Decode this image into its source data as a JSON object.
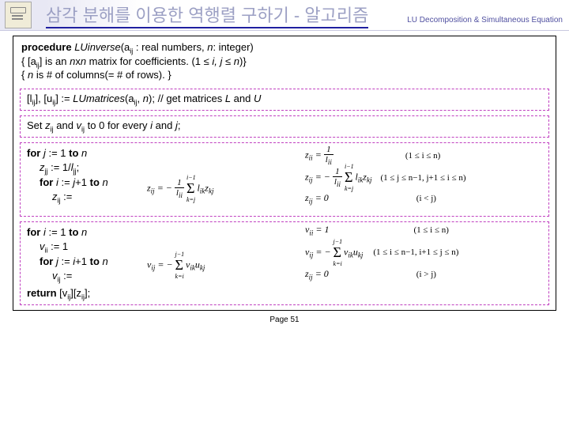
{
  "header": {
    "title": "삼각 분해를 이용한 역행렬 구하기 - 알고리즘",
    "subtitle": "LU Decomposition & Simultaneous Equation"
  },
  "intro": {
    "l1a": "procedure ",
    "l1b": "LUinverse",
    "l1c": "(a",
    "l1d": "ij",
    "l1e": " : real numbers, ",
    "l1f": "n",
    "l1g": ": integer)",
    "l2a": "{ [a",
    "l2b": "ij",
    "l2c": "] is an ",
    "l2d": "n",
    "l2e": "x",
    "l2f": "n",
    "l2g": " matrix for coefficients. (1 ≤ ",
    "l2h": "i, j",
    "l2i": " ≤ ",
    "l2j": "n",
    "l2k": ")}",
    "l3a": "{ ",
    "l3b": "n",
    "l3c": " is # of columns(= # of rows). }"
  },
  "box1": {
    "a": "[l",
    "as": "ij",
    "b": "], [u",
    "bs": "ij",
    "c": "] := ",
    "d": "LUmatrices",
    "e": "(a",
    "es": "ij",
    "f": ", ",
    "g": "n",
    "h": ");  // get matrices ",
    "i": "L",
    "j": " and ",
    "k": "U"
  },
  "box2": {
    "a": "Set ",
    "b": "z",
    "bs": "ij",
    "c": " and ",
    "d": "v",
    "ds": "ij",
    "e": " to 0 for every ",
    "f": "i",
    "g": " and ",
    "h": "j",
    "i": ";"
  },
  "box3": {
    "l1a": "for ",
    "l1b": "j",
    "l1c": " := 1 ",
    "l1d": "to ",
    "l1e": "n",
    "l2a": "z",
    "l2s": "jj",
    "l2b": " := 1/",
    "l2c": "l",
    "l2cs": "jj",
    "l2d": ";",
    "l3a": "for ",
    "l3b": "i",
    "l3c": " := ",
    "l3d": "j",
    "l3e": "+1 ",
    "l3f": "to ",
    "l3g": "n",
    "l4a": "z",
    "l4s": "ij",
    "l4b": " :="
  },
  "math3": {
    "e1a": "z",
    "e1s": "ii",
    "e1b": " = ",
    "e1num": "1",
    "e1den": "l",
    "e1dens": "ii",
    "e1c": "(1 ≤ i ≤ n)",
    "e2a": "z",
    "e2s": "ij",
    "e2b": " = − ",
    "e2num": "1",
    "e2den": "l",
    "e2dens": "ii",
    "e2sum": "Σ",
    "e2top": "i−1",
    "e2bot": "k=j",
    "e2c": "l",
    "e2cs": "ik",
    "e2d": "z",
    "e2ds": "kj",
    "e2cond": "(1 ≤ j ≤ n−1, j+1 ≤ i ≤ n)",
    "e3a": "z",
    "e3s": "ij",
    "e3b": " = 0",
    "e3c": "(i < j)",
    "mid1": "z",
    "mids1": "ij",
    "mid2": " = − ",
    "midnum": "1",
    "midden": "l",
    "middens": "ii",
    "midsum": "Σ",
    "midtop": "i−1",
    "midbot": "k=j",
    "midc": "l",
    "midcs": "ik",
    "midd": "z",
    "midds": "kj"
  },
  "box4": {
    "l1a": "for ",
    "l1b": "i",
    "l1c": " := 1 ",
    "l1d": "to ",
    "l1e": "n",
    "l2a": "v",
    "l2s": "ii",
    "l2b": " := 1",
    "l3a": "for ",
    "l3b": "j",
    "l3c": " := ",
    "l3d": "i",
    "l3e": "+1 ",
    "l3f": "to ",
    "l3g": "n",
    "l4a": "v",
    "l4s": "ij",
    "l4b": " :=",
    "l5a": "return ",
    "l5b": "[v",
    "l5s": "ij",
    "l5c": "][z",
    "l5cs": "ij",
    "l5d": "];"
  },
  "math4": {
    "e1a": "v",
    "e1s": "ii",
    "e1b": " = 1",
    "e1c": "(1 ≤ i ≤ n)",
    "e2a": "v",
    "e2s": "ij",
    "e2b": " = − ",
    "e2sum": "Σ",
    "e2top": "j−1",
    "e2bot": "k=i",
    "e2c": "v",
    "e2cs": "ik",
    "e2d": "u",
    "e2ds": "kj",
    "e2cond": "(1 ≤ i ≤ n−1, i+1 ≤ j ≤ n)",
    "e3a": "z",
    "e3s": "ij",
    "e3b": " = 0",
    "e3c": "(i > j)",
    "mid1": "v",
    "mids1": "ij",
    "mid2": " = − ",
    "midsum": "Σ",
    "midtop": "j−1",
    "midbot": "k=i",
    "midc": "v",
    "midcs": "ik",
    "midd": "u",
    "midds": "kj"
  },
  "page": "Page 51"
}
